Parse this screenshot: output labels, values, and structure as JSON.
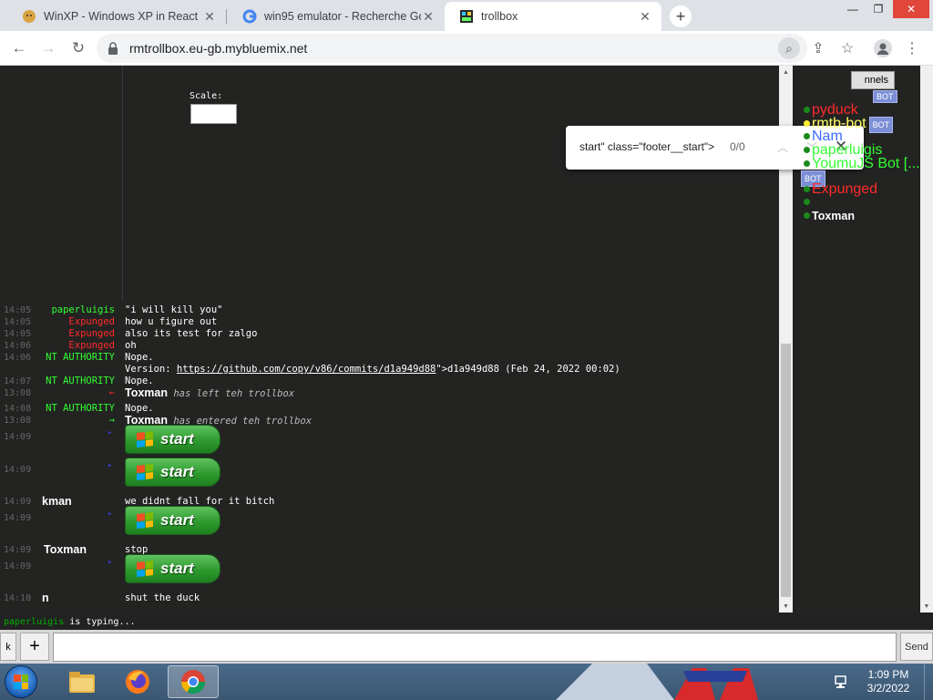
{
  "browser": {
    "tabs": [
      {
        "title": "WinXP - Windows XP in React",
        "favicon": "doge-icon",
        "active": false
      },
      {
        "title": "win95 emulator - Recherche Goo",
        "favicon": "google-icon",
        "active": false
      },
      {
        "title": "trollbox",
        "favicon": "trollbox-icon",
        "active": true
      }
    ],
    "url": "rmtrollbox.eu-gb.mybluemix.net"
  },
  "find": {
    "query": "start\" class=\"footer__start\">",
    "count": "0/0"
  },
  "scale_label": "Scale:",
  "channels_label": "nnels",
  "users": [
    {
      "name": "pyduck",
      "color": "#ff2a2a",
      "dot": "#1a8a1a",
      "bot": false
    },
    {
      "name": "rmtb-bot",
      "color": "#ffff66",
      "dot": "#ffee33",
      "bot": true
    },
    {
      "name": "Nam",
      "color": "#3b6bff",
      "dot": "#1a8a1a",
      "bot": false
    },
    {
      "name": "paperluigis",
      "color": "#33ff33",
      "dot": "#1a8a1a",
      "bot": false
    },
    {
      "name": "YoumuJS Bot [...",
      "color": "#33ff33",
      "dot": "#1a8a1a",
      "bot": true
    },
    {
      "name": "Expunged",
      "color": "#ff2a2a",
      "dot": "#1a8a1a",
      "bot": false
    },
    {
      "name": "",
      "color": "#ffffff",
      "dot": "#1a8a1a",
      "bot": false
    },
    {
      "name": "Toxman",
      "color": "#ffffff",
      "dot": "#1a8a1a",
      "bot": false
    }
  ],
  "bot_badge": "BOT",
  "messages": [
    {
      "time": "14:05",
      "nick": "paperluigis",
      "nick_color": "#33ff33",
      "text": "\"i will kill you\""
    },
    {
      "time": "14:05",
      "nick": "Expunged",
      "nick_color": "#ff2a2a",
      "text": "how u figure out"
    },
    {
      "time": "14:05",
      "nick": "Expunged",
      "nick_color": "#ff2a2a",
      "text": "also its test for zalgo"
    },
    {
      "time": "14:06",
      "nick": "Expunged",
      "nick_color": "#ff2a2a",
      "text": "oh"
    },
    {
      "time": "14:06",
      "nick": "NT AUTHORITY",
      "nick_color": "#33ff33",
      "text": "Nope."
    },
    {
      "time": "",
      "nick": "",
      "nick_color": "#33ff33",
      "text": "Version: ",
      "link": "https://github.com/copy/v86/commits/d1a949d88",
      "after": "\">d1a949d88 (Feb 24, 2022 00:02)"
    },
    {
      "time": "14:07",
      "nick": "NT AUTHORITY",
      "nick_color": "#33ff33",
      "text": "Nope."
    },
    {
      "time": "13:08",
      "nick": "←",
      "nick_color": "#ff2a2a",
      "text": "Toxman",
      "event": "has left teh trollbox"
    },
    {
      "time": "14:08",
      "nick": "NT AUTHORITY",
      "nick_color": "#33ff33",
      "text": "Nope."
    },
    {
      "time": "13:08",
      "nick": "→",
      "nick_color": "#33ff33",
      "text": "Toxman",
      "event": "has entered teh trollbox"
    },
    {
      "time": "14:09",
      "nick": "▸",
      "nick_color": "#3b3bd6",
      "start": true
    },
    {
      "time": "14:09",
      "nick": "▸",
      "nick_color": "#3b3bd6",
      "start": true
    },
    {
      "time": "14:09",
      "nick": "kman",
      "nick_color": "#ffffff",
      "text": "we didnt fall for it bitch",
      "bignick": true
    },
    {
      "time": "14:09",
      "nick": "▸",
      "nick_color": "#3b3bd6",
      "start": true
    },
    {
      "time": "14:09",
      "nick": "Toxman",
      "nick_color": "#ffffff",
      "text": "stop",
      "bignick": true
    },
    {
      "time": "14:09",
      "nick": "▸",
      "nick_color": "#3b3bd6",
      "start": true
    },
    {
      "time": "14:10",
      "nick": "n",
      "nick_color": "#ffffff",
      "text": "shut the duck",
      "bignick": true
    }
  ],
  "start_label": "start",
  "typing": {
    "nick": "paperluigis",
    "text": "is typing..."
  },
  "input": {
    "k_label": "k",
    "plus_label": "+",
    "send_label": "Send",
    "value": ""
  },
  "clock": {
    "time": "1:09 PM",
    "date": "3/2/2022"
  }
}
